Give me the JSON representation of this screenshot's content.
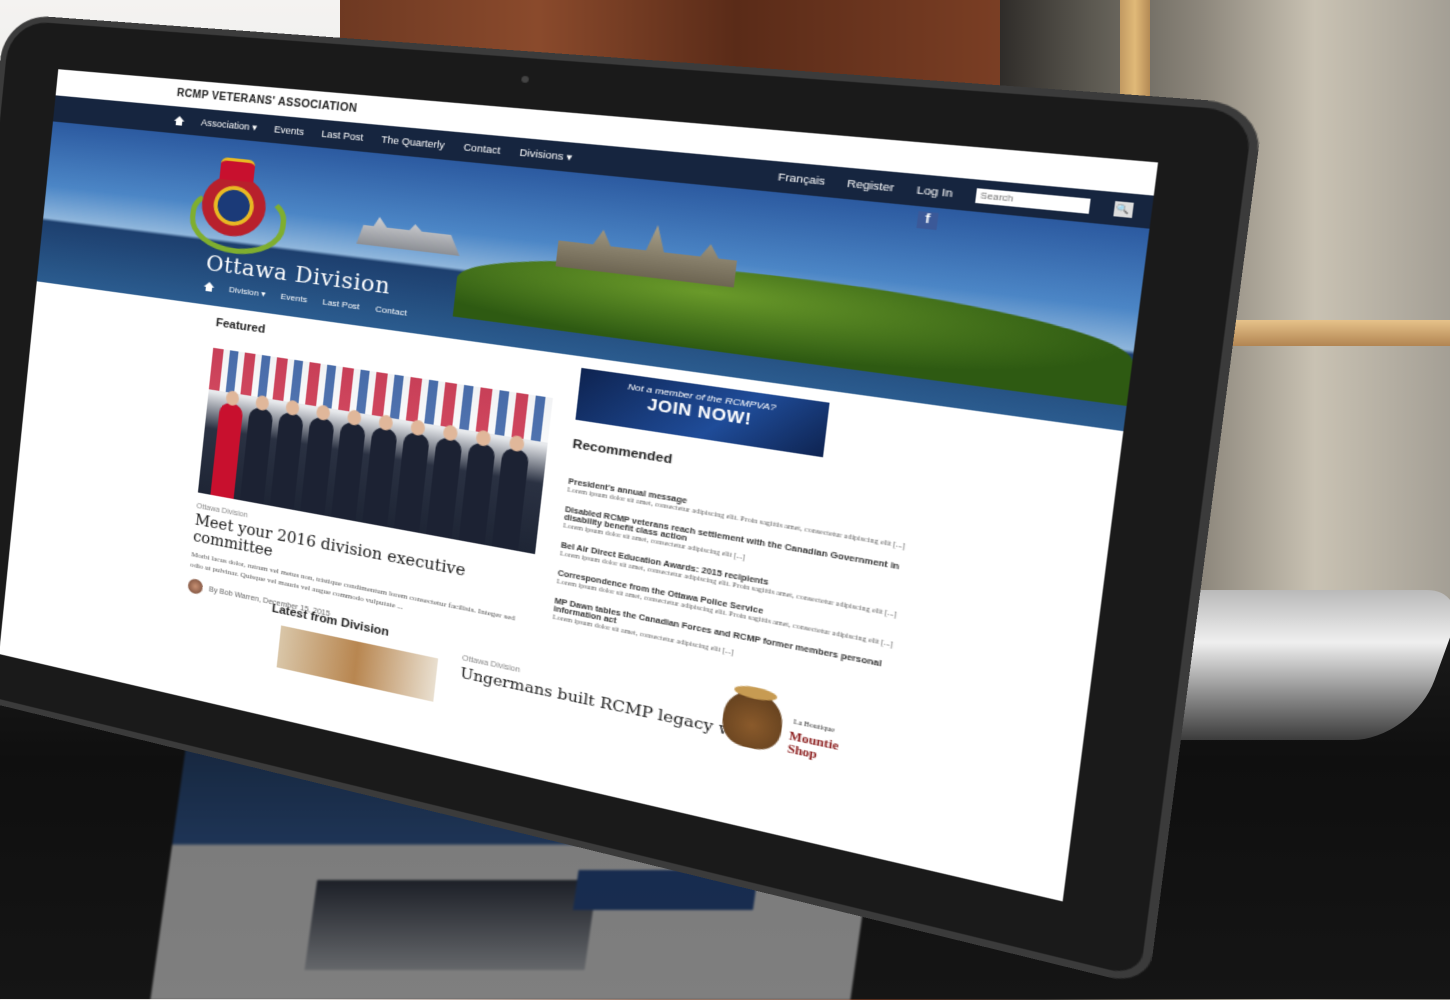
{
  "site": {
    "brand": "RCMP VETERANS' ASSOCIATION",
    "main_nav": [
      "Association ▾",
      "Events",
      "Last Post",
      "The Quarterly",
      "Contact",
      "Divisions ▾"
    ],
    "utility_nav": [
      "Français",
      "Register",
      "Log In"
    ],
    "search_placeholder": "Search",
    "facebook_label": "f"
  },
  "hero": {
    "title": "Ottawa Division",
    "sub_nav": [
      "Division ▾",
      "Events",
      "Last Post",
      "Contact"
    ]
  },
  "featured": {
    "heading": "Featured",
    "kicker": "Ottawa Division",
    "title": "Meet your 2016 division executive committee",
    "excerpt": "Morbi lacus dolor, rutrum vel metus non, tristique condimentum lorem consectetur facilisis. Integer sed odio ut pulvinar. Quisque vel mauris vel augue commodo vulputate ...",
    "byline": "By Bob Warren, December 15, 2015"
  },
  "sidebar": {
    "join_small": "Not a member of the RCMPVA?",
    "join_big": "JOIN NOW!",
    "recommended_heading": "Recommended",
    "items": [
      {
        "title": "President's annual message",
        "text": "Lorem ipsum dolor sit amet, consectetur adipiscing elit. Proin sagittis amet, consectetur adipiscing elit [...]"
      },
      {
        "title": "Disabled RCMP veterans reach settlement with the Canadian Government in disability benefit class action",
        "text": "Lorem ipsum dolor sit amet, consectetur adipiscing elit [...]"
      },
      {
        "title": "Bel Air Direct Education Awards: 2015 recipients",
        "text": "Lorem ipsum dolor sit amet, consectetur adipiscing elit. Proin sagittis amet, consectetur adipiscing elit [...]"
      },
      {
        "title": "Correspondence from the Ottawa Police Service",
        "text": "Lorem ipsum dolor sit amet, consectetur adipiscing elit. Proin sagittis amet, consectetur adipiscing elit [...]"
      },
      {
        "title": "MP Dawn tables the Canadian Forces and RCMP former members personal information act",
        "text": "Lorem ipsum dolor sit amet, consectetur adipiscing elit [...]"
      }
    ]
  },
  "latest": {
    "heading": "Latest from Division",
    "kicker": "Ottawa Division",
    "title": "Ungermans built RCMP legacy with"
  },
  "ad": {
    "small": "La Boutique",
    "text": "Mountie Shop"
  }
}
